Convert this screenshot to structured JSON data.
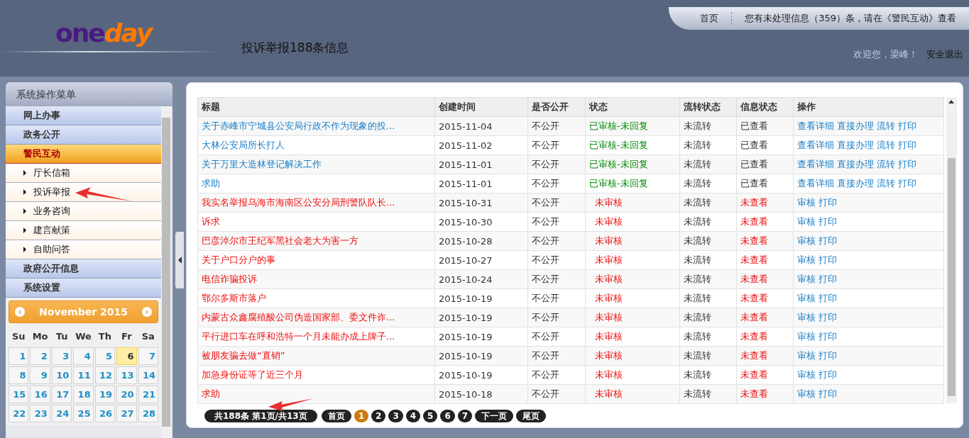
{
  "header": {
    "logo": {
      "part_1": "one",
      "part_2": "day"
    },
    "page_title": "投诉举报188条信息",
    "top_links": [
      {
        "label": "首页"
      },
      {
        "label": "您有未处理信息（359）条，请在《警民互动》查看"
      }
    ],
    "welcome": "欢迎您，梁峰！",
    "logout": "安全退出"
  },
  "sidebar": {
    "title": "系统操作菜单",
    "sections": [
      {
        "label": "网上办事",
        "selected": false
      },
      {
        "label": "政务公开",
        "selected": false
      },
      {
        "label": "警民互动",
        "selected": true,
        "children": [
          {
            "label": "厅长信箱"
          },
          {
            "label": "投诉举报"
          },
          {
            "label": "业务咨询"
          },
          {
            "label": "建言献策"
          },
          {
            "label": "自助问答"
          }
        ]
      },
      {
        "label": "政府公开信息",
        "selected": false
      },
      {
        "label": "系统设置",
        "selected": false
      }
    ]
  },
  "calendar": {
    "prev": "‹",
    "month": "November 2015",
    "next": "›",
    "weekdays": [
      "Su",
      "Mo",
      "Tu",
      "We",
      "Th",
      "Fr",
      "Sa"
    ],
    "weeks": [
      [
        {
          "label": "1",
          "selected": false
        },
        {
          "label": "2",
          "selected": false
        },
        {
          "label": "3",
          "selected": false
        },
        {
          "label": "4",
          "selected": false
        },
        {
          "label": "5",
          "selected": false
        },
        {
          "label": "6",
          "selected": true
        },
        {
          "label": "7",
          "selected": false
        }
      ],
      [
        {
          "label": "8",
          "selected": false
        },
        {
          "label": "9",
          "selected": false
        },
        {
          "label": "10",
          "selected": false
        },
        {
          "label": "11",
          "selected": false
        },
        {
          "label": "12",
          "selected": false
        },
        {
          "label": "13",
          "selected": false
        },
        {
          "label": "14",
          "selected": false
        }
      ],
      [
        {
          "label": "15",
          "selected": false
        },
        {
          "label": "16",
          "selected": false
        },
        {
          "label": "17",
          "selected": false
        },
        {
          "label": "18",
          "selected": false
        },
        {
          "label": "19",
          "selected": false
        },
        {
          "label": "20",
          "selected": false
        },
        {
          "label": "21",
          "selected": false
        }
      ],
      [
        {
          "label": "22",
          "selected": false
        },
        {
          "label": "23",
          "selected": false
        },
        {
          "label": "24",
          "selected": false
        },
        {
          "label": "25",
          "selected": false
        },
        {
          "label": "26",
          "selected": false
        },
        {
          "label": "27",
          "selected": false
        },
        {
          "label": "28",
          "selected": false
        }
      ]
    ]
  },
  "table": {
    "columns": [
      "标题",
      "创建时间",
      "是否公开",
      "状态",
      "流转状态",
      "信息状态",
      "操作"
    ],
    "rows": [
      {
        "title": "关于赤峰市宁城县公安局行政不作为现象的投...",
        "created": "2015-11-04",
        "public": "不公开",
        "kind": "reviewed",
        "status": "已审核-未回复",
        "transfer": "未流转",
        "viewed": true,
        "info": "已查看",
        "actions": [
          "查看详细",
          "直接办理",
          "流转",
          "打印"
        ]
      },
      {
        "title": "大林公安局所长打人",
        "created": "2015-11-02",
        "public": "不公开",
        "kind": "reviewed",
        "status": "已审核-未回复",
        "transfer": "未流转",
        "viewed": true,
        "info": "已查看",
        "actions": [
          "查看详细",
          "直接办理",
          "流转",
          "打印"
        ]
      },
      {
        "title": "关于万里大造林登记解决工作",
        "created": "2015-11-01",
        "public": "不公开",
        "kind": "reviewed",
        "status": "已审核-未回复",
        "transfer": "未流转",
        "viewed": true,
        "info": "已查看",
        "actions": [
          "查看详细",
          "直接办理",
          "流转",
          "打印"
        ]
      },
      {
        "title": "求助",
        "created": "2015-11-01",
        "public": "不公开",
        "kind": "reviewed",
        "status": "已审核-未回复",
        "transfer": "未流转",
        "viewed": true,
        "info": "已查看",
        "actions": [
          "查看详细",
          "直接办理",
          "流转",
          "打印"
        ]
      },
      {
        "title": "我实名举报乌海市海南区公安分局刑警队队长...",
        "created": "2015-10-31",
        "public": "不公开",
        "kind": "pending",
        "status": "未审核",
        "transfer": "未流转",
        "viewed": false,
        "info": "未查看",
        "actions": [
          "审核",
          "打印"
        ]
      },
      {
        "title": "诉求",
        "created": "2015-10-30",
        "public": "不公开",
        "kind": "pending",
        "status": "未审核",
        "transfer": "未流转",
        "viewed": false,
        "info": "未查看",
        "actions": [
          "审核",
          "打印"
        ]
      },
      {
        "title": "巴彦淖尔市王纪军黑社会老大为害一方",
        "created": "2015-10-28",
        "public": "不公开",
        "kind": "pending",
        "status": "未审核",
        "transfer": "未流转",
        "viewed": false,
        "info": "未查看",
        "actions": [
          "审核",
          "打印"
        ]
      },
      {
        "title": "关于户口分户的事",
        "created": "2015-10-27",
        "public": "不公开",
        "kind": "pending",
        "status": "未审核",
        "transfer": "未流转",
        "viewed": false,
        "info": "未查看",
        "actions": [
          "审核",
          "打印"
        ]
      },
      {
        "title": "电信诈骗投诉",
        "created": "2015-10-24",
        "public": "不公开",
        "kind": "pending",
        "status": "未审核",
        "transfer": "未流转",
        "viewed": false,
        "info": "未查看",
        "actions": [
          "审核",
          "打印"
        ]
      },
      {
        "title": "鄂尔多斯市落户",
        "created": "2015-10-19",
        "public": "不公开",
        "kind": "pending",
        "status": "未审核",
        "transfer": "未流转",
        "viewed": false,
        "info": "未查看",
        "actions": [
          "审核",
          "打印"
        ]
      },
      {
        "title": "内蒙古众鑫腐殖酸公司伪造国家部、委文件诈...",
        "created": "2015-10-19",
        "public": "不公开",
        "kind": "pending",
        "status": "未审核",
        "transfer": "未流转",
        "viewed": false,
        "info": "未查看",
        "actions": [
          "审核",
          "打印"
        ]
      },
      {
        "title": "平行进口车在呼和浩特一个月未能办成上牌子...",
        "created": "2015-10-19",
        "public": "不公开",
        "kind": "pending",
        "status": "未审核",
        "transfer": "未流转",
        "viewed": false,
        "info": "未查看",
        "actions": [
          "审核",
          "打印"
        ]
      },
      {
        "title": "被朋友骗去做“直销”",
        "created": "2015-10-19",
        "public": "不公开",
        "kind": "pending",
        "status": "未审核",
        "transfer": "未流转",
        "viewed": false,
        "info": "未查看",
        "actions": [
          "审核",
          "打印"
        ]
      },
      {
        "title": "加急身份证等了近三个月",
        "created": "2015-10-19",
        "public": "不公开",
        "kind": "pending",
        "status": "未审核",
        "transfer": "未流转",
        "viewed": false,
        "info": "未查看",
        "actions": [
          "审核",
          "打印"
        ]
      },
      {
        "title": "求助",
        "created": "2015-10-18",
        "public": "不公开",
        "kind": "pending",
        "status": "未审核",
        "transfer": "未流转",
        "viewed": false,
        "info": "未查看",
        "actions": [
          "审核",
          "打印"
        ]
      }
    ]
  },
  "pagination": {
    "summary": "共188条 第1页/共13页",
    "first": "首页",
    "pages": [
      {
        "label": "1",
        "selected": true
      },
      {
        "label": "2",
        "selected": false
      },
      {
        "label": "3",
        "selected": false
      },
      {
        "label": "4",
        "selected": false
      },
      {
        "label": "5",
        "selected": false
      },
      {
        "label": "6",
        "selected": false
      },
      {
        "label": "7",
        "selected": false
      }
    ],
    "next": "下一页",
    "last": "尾页"
  }
}
